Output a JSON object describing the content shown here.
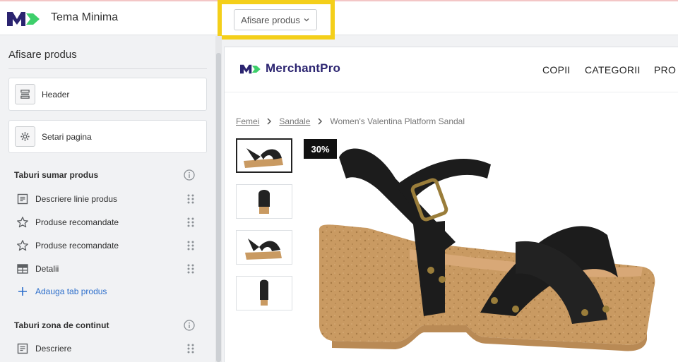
{
  "app": {
    "title": "Tema Minima",
    "page_selector": "Afisare produs"
  },
  "sidebar": {
    "title": "Afisare produs",
    "cards": [
      {
        "label": "Header",
        "icon": "header-layout-icon"
      },
      {
        "label": "Setari pagina",
        "icon": "gear-icon"
      }
    ],
    "sections": [
      {
        "title": "Taburi sumar produs",
        "items": [
          {
            "label": "Descriere linie produs",
            "icon": "text-block-icon"
          },
          {
            "label": "Produse recomandate",
            "icon": "star-icon"
          },
          {
            "label": "Produse recomandate",
            "icon": "star-icon"
          },
          {
            "label": "Detalii",
            "icon": "table-icon"
          }
        ],
        "add_label": "Adauga tab produs"
      },
      {
        "title": "Taburi zona de continut",
        "items": [
          {
            "label": "Descriere",
            "icon": "text-block-icon"
          }
        ]
      }
    ]
  },
  "preview": {
    "store_name": "MerchantPro",
    "nav": [
      "COPII",
      "CATEGORII",
      "PRO"
    ],
    "breadcrumb": {
      "links": [
        "Femei",
        "Sandale"
      ],
      "current": "Women's Valentina Platform Sandal"
    },
    "discount_badge": "30%",
    "thumbnails": 4
  },
  "colors": {
    "highlight": "#f4cf1a",
    "brand_navy": "#2b2470",
    "brand_green": "#3ecf6b",
    "link_blue": "#2c6ecb"
  }
}
